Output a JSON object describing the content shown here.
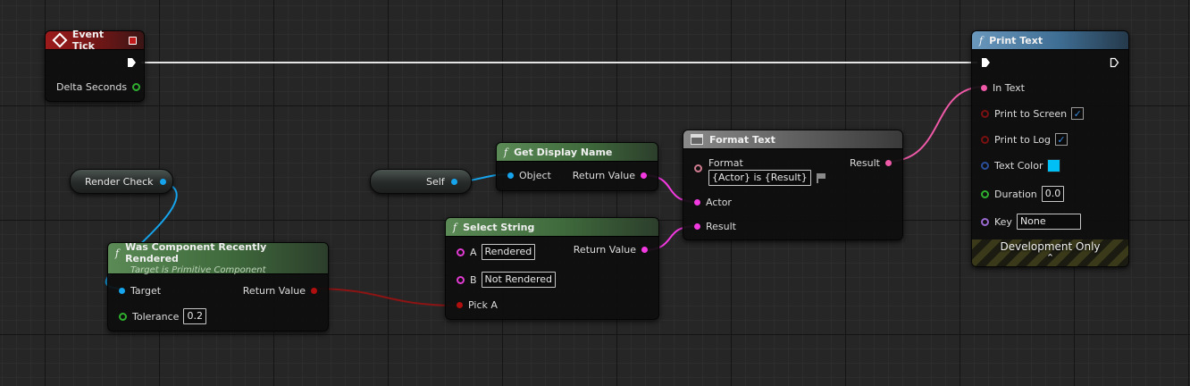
{
  "nodes": {
    "event_tick": {
      "title": "Event Tick",
      "delta_seconds": "Delta Seconds"
    },
    "render_check": {
      "label": "Render Check"
    },
    "was_component_recently_rendered": {
      "title": "Was Component Recently Rendered",
      "subtitle": "Target is Primitive Component",
      "target": "Target",
      "return_value": "Return Value",
      "tolerance_label": "Tolerance",
      "tolerance_value": "0.2"
    },
    "self": {
      "label": "Self"
    },
    "get_display_name": {
      "title": "Get Display Name",
      "object": "Object",
      "return_value": "Return Value"
    },
    "select_string": {
      "title": "Select String",
      "a_label": "A",
      "a_value": "Rendered",
      "b_label": "B",
      "b_value": "Not Rendered",
      "pick_a": "Pick A",
      "return_value": "Return Value"
    },
    "format_text": {
      "title": "Format Text",
      "format_label": "Format",
      "format_value": "{Actor} is {Result}",
      "result_out": "Result",
      "actor": "Actor",
      "result_in": "Result"
    },
    "print_text": {
      "title": "Print Text",
      "in_text": "In Text",
      "print_to_screen": "Print to Screen",
      "print_to_log": "Print to Log",
      "text_color": "Text Color",
      "duration_label": "Duration",
      "duration_value": "0.0",
      "key_label": "Key",
      "key_value": "None",
      "development_only": "Development Only",
      "print_to_screen_checked": true,
      "print_to_log_checked": true,
      "text_color_hex": "#00bff5"
    }
  },
  "icons": {
    "function": "f",
    "event": "event-diamond-icon",
    "checkmark": "✓",
    "expand": "⌃"
  },
  "colors": {
    "exec_wire": "#e6e6e6",
    "object_wire": "#16a4ec",
    "string_wire": "#f23ae0",
    "text_wire": "#ef5aa8",
    "bool_wire": "#8c1414"
  }
}
